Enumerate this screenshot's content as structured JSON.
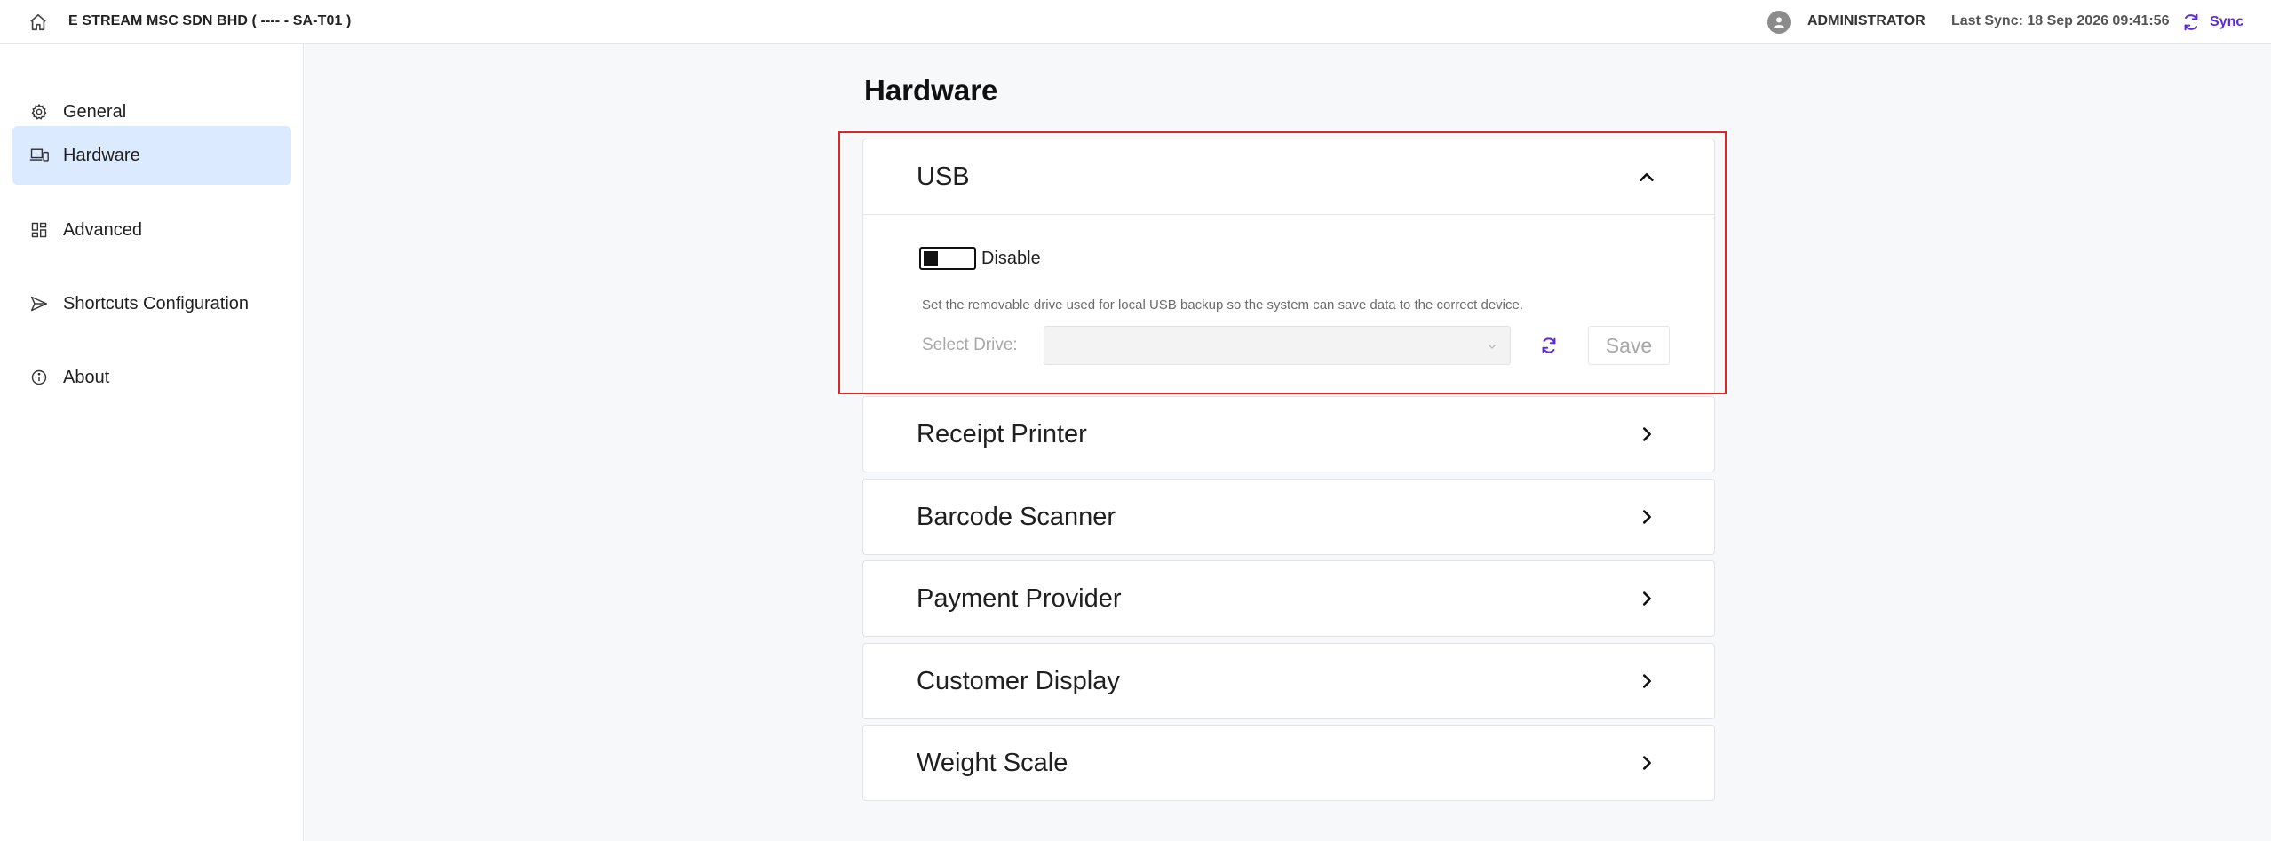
{
  "header": {
    "company": "E STREAM MSC SDN BHD ( ---- - SA-T01 )",
    "username": "ADMINISTRATOR",
    "last_sync": "Last Sync: 18 Sep 2026 09:41:56",
    "sync_label": "Sync",
    "icons": {
      "home": "home-icon",
      "avatar": "user-avatar-icon",
      "sync": "sync-icon"
    },
    "accent_color": "#5b2bd9"
  },
  "sidebar": {
    "items": [
      {
        "label": "General",
        "icon": "gear-icon",
        "active": false
      },
      {
        "label": "Hardware",
        "icon": "devices-icon",
        "active": true
      },
      {
        "label": "Advanced",
        "icon": "grid-icon",
        "active": false
      },
      {
        "label": "Shortcuts Configuration",
        "icon": "send-icon",
        "active": false
      },
      {
        "label": "About",
        "icon": "info-icon",
        "active": false
      }
    ],
    "active_color": "#dbeafe"
  },
  "main": {
    "title": "Hardware",
    "usb": {
      "title": "USB",
      "expanded": true,
      "toggle_label": "Disable",
      "description": "Set the removable drive used for local USB backup so the system can save data to the correct device.",
      "drive_label": "Select Drive:",
      "drive_value": "",
      "save_label": "Save"
    },
    "panels": [
      {
        "title": "Receipt Printer"
      },
      {
        "title": "Barcode Scanner"
      },
      {
        "title": "Payment Provider"
      },
      {
        "title": "Customer Display"
      },
      {
        "title": "Weight Scale"
      }
    ],
    "highlight_color": "#e02424"
  }
}
